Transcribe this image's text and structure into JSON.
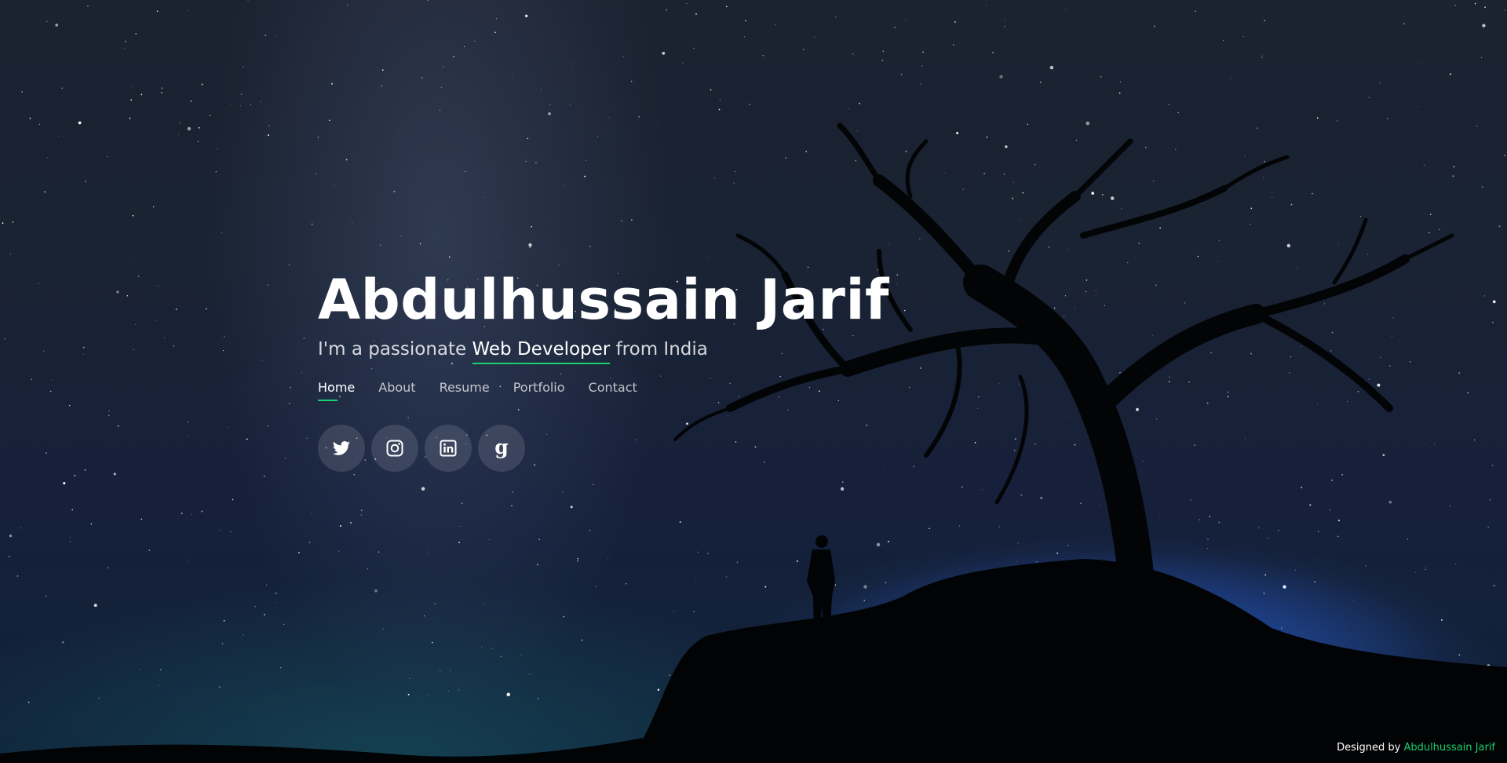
{
  "hero": {
    "name": "Abdulhussain Jarif",
    "tagline": {
      "prefix": "I'm a passionate",
      "role": "Web Developer",
      "suffix": "from India"
    }
  },
  "nav": {
    "items": [
      {
        "label": "Home",
        "active": true
      },
      {
        "label": "About",
        "active": false
      },
      {
        "label": "Resume",
        "active": false
      },
      {
        "label": "Portfolio",
        "active": false
      },
      {
        "label": "Contact",
        "active": false
      }
    ]
  },
  "social": [
    {
      "icon": "twitter-icon"
    },
    {
      "icon": "instagram-icon"
    },
    {
      "icon": "linkedin-icon"
    },
    {
      "icon": "google-plus-icon"
    }
  ],
  "footer": {
    "credit_prefix": "Designed by",
    "credit_name": "Abdulhussain Jarif"
  },
  "colors": {
    "accent": "#18d26e",
    "text": "#ffffff",
    "background": "#1a2333"
  }
}
